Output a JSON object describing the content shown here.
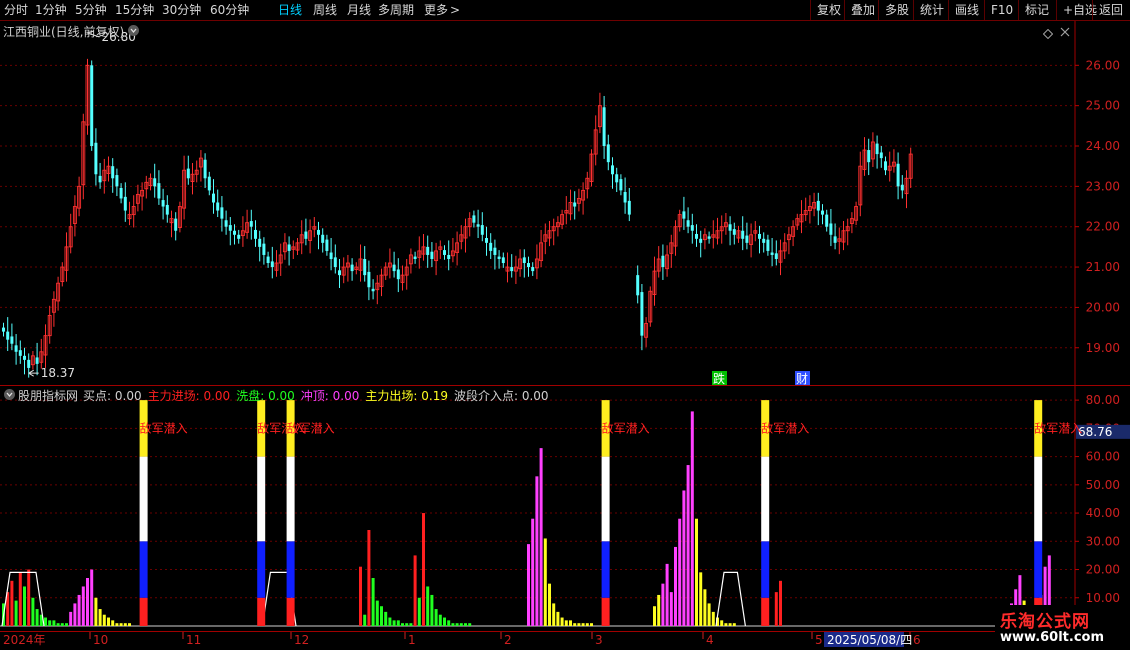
{
  "toolbar": {
    "periods": [
      {
        "label": "分时",
        "name": "tab-fenshi"
      },
      {
        "label": "1分钟",
        "name": "tab-1min"
      },
      {
        "label": "5分钟",
        "name": "tab-5min"
      },
      {
        "label": "15分钟",
        "name": "tab-15min"
      },
      {
        "label": "30分钟",
        "name": "tab-30min"
      },
      {
        "label": "60分钟",
        "name": "tab-60min"
      },
      {
        "label": "日线",
        "name": "tab-daily"
      },
      {
        "label": "周线",
        "name": "tab-weekly"
      },
      {
        "label": "月线",
        "name": "tab-monthly"
      },
      {
        "label": "多周期",
        "name": "tab-multi-period"
      },
      {
        "label": "更多",
        "name": "tab-more"
      }
    ],
    "more_arrow": ">",
    "active_period": "日线",
    "actions": [
      {
        "label": "复权",
        "name": "adjust-button"
      },
      {
        "label": "叠加",
        "name": "overlay-button"
      },
      {
        "label": "多股",
        "name": "multi-stock-button"
      },
      {
        "label": "统计",
        "name": "statistics-button"
      },
      {
        "label": "画线",
        "name": "draw-line-button"
      },
      {
        "label": "F10",
        "name": "f10-button"
      },
      {
        "label": "标记",
        "name": "mark-button"
      },
      {
        "label": "+自选",
        "name": "add-watchlist-button"
      },
      {
        "label": "返回",
        "name": "back-button"
      }
    ]
  },
  "main_chart": {
    "title": "江西铜业(日线,前复权)",
    "y_ticks": [
      "26.00",
      "25.00",
      "24.00",
      "23.00",
      "22.00",
      "21.00",
      "20.00",
      "19.00"
    ],
    "high_label": "26.80",
    "low_label": "18.37",
    "events": [
      {
        "label": "跌",
        "color": "#00c000"
      },
      {
        "label": "财",
        "color": "#3050ff"
      }
    ],
    "up_color": "#ff3030",
    "down_color": "#54ffff"
  },
  "indicator": {
    "name": "股朋指标网",
    "items": [
      {
        "label": "买点",
        "value": "0.00",
        "color": "#d0d0d0"
      },
      {
        "label": "主力进场",
        "value": "0.00",
        "color": "#ff2020"
      },
      {
        "label": "洗盘",
        "value": "0.00",
        "color": "#20ff20"
      },
      {
        "label": "冲顶",
        "value": "0.00",
        "color": "#ff40ff"
      },
      {
        "label": "主力出场",
        "value": "0.19",
        "color": "#ffff20"
      },
      {
        "label": "波段介入点",
        "value": "0.00",
        "color": "#d0d0d0"
      }
    ],
    "y_ticks": [
      "80.00",
      "70.00",
      "60.00",
      "50.00",
      "40.00",
      "30.00",
      "20.00",
      "10.00"
    ],
    "current_value": "68.76",
    "signal_text": "敌军潜入"
  },
  "time_axis": {
    "start_label": "2024年",
    "months": [
      "10",
      "11",
      "12",
      "1",
      "2",
      "3",
      "4",
      "5",
      "6"
    ],
    "cursor_date": "2025/05/08/四"
  },
  "watermark": {
    "title": "乐淘公式网",
    "url": "www.60lt.com"
  },
  "chart_data": [
    {
      "type": "candlestick",
      "title": "江西铜业(日线,前复权)",
      "ylim": [
        18.3,
        26.9
      ],
      "high": 26.8,
      "low": 18.37,
      "closes": [
        19.4,
        19.2,
        19.1,
        18.9,
        18.8,
        18.7,
        18.5,
        18.8,
        18.6,
        18.9,
        19.3,
        19.8,
        20.2,
        20.6,
        21.0,
        21.5,
        22.0,
        22.5,
        23.0,
        24.6,
        26.0,
        24.0,
        23.3,
        23.1,
        23.4,
        23.5,
        23.2,
        23.0,
        22.7,
        22.4,
        22.3,
        22.5,
        22.8,
        22.9,
        23.1,
        23.2,
        23.0,
        22.7,
        22.5,
        22.3,
        22.2,
        21.9,
        22.5,
        23.4,
        23.2,
        23.3,
        23.4,
        23.7,
        23.2,
        22.9,
        22.6,
        22.4,
        22.2,
        22.0,
        21.9,
        21.8,
        21.7,
        21.9,
        22.1,
        22.0,
        21.7,
        21.5,
        21.3,
        21.1,
        21.0,
        21.1,
        21.3,
        21.6,
        21.4,
        21.5,
        21.6,
        21.8,
        21.7,
        21.9,
        22.0,
        21.8,
        21.6,
        21.4,
        21.2,
        21.0,
        20.8,
        21.0,
        21.1,
        20.9,
        21.0,
        21.2,
        20.8,
        20.5,
        20.4,
        20.6,
        20.8,
        21.0,
        21.1,
        20.9,
        20.7,
        20.8,
        21.0,
        21.3,
        21.2,
        21.4,
        21.5,
        21.3,
        21.2,
        21.4,
        21.5,
        21.3,
        21.2,
        21.4,
        21.6,
        21.8,
        22.0,
        22.2,
        22.1,
        22.0,
        21.8,
        21.6,
        21.4,
        21.3,
        21.2,
        21.1,
        21.0,
        20.9,
        21.0,
        21.2,
        21.1,
        21.0,
        20.9,
        21.2,
        21.6,
        21.8,
        21.9,
        22.0,
        22.1,
        22.3,
        22.4,
        22.6,
        22.5,
        22.7,
        22.9,
        23.2,
        23.8,
        24.4,
        25.0,
        24.0,
        23.6,
        23.3,
        23.1,
        22.9,
        22.6,
        22.3,
        null,
        20.3,
        19.3,
        19.6,
        20.4,
        20.9,
        21.2,
        21.0,
        21.3,
        21.6,
        22.0,
        22.3,
        22.2,
        22.0,
        21.9,
        21.7,
        21.6,
        21.8,
        21.7,
        21.8,
        21.9,
        22.0,
        22.1,
        21.9,
        21.8,
        21.9,
        21.7,
        21.6,
        21.8,
        21.9,
        21.7,
        21.6,
        21.4,
        21.3,
        21.2,
        21.4,
        21.6,
        21.8,
        22.0,
        22.2,
        22.3,
        22.4,
        22.5,
        22.6,
        22.4,
        22.3,
        22.0,
        21.8,
        21.6,
        21.7,
        21.9,
        22.0,
        22.2,
        22.5,
        23.5,
        23.9,
        23.6,
        24.1,
        23.8,
        23.7,
        23.4,
        23.5,
        23.6,
        23.0,
        22.9,
        23.2,
        23.8
      ],
      "events": [
        "跌",
        "财"
      ]
    },
    {
      "type": "bar",
      "title": "股朋指标网",
      "ylim": [
        0,
        85
      ],
      "current_value": 68.76,
      "signal_value": 0.19,
      "series": [
        {
          "name": "主力进场",
          "color": "#ff2020",
          "bars": [
            [
              1,
              12
            ],
            [
              2,
              16
            ],
            [
              4,
              19
            ],
            [
              6,
              20
            ],
            [
              85,
              21
            ],
            [
              87,
              34
            ],
            [
              98,
              25
            ],
            [
              100,
              40
            ],
            [
              184,
              12
            ],
            [
              185,
              16
            ]
          ]
        },
        {
          "name": "洗盘",
          "color": "#20ff20",
          "bars": [
            [
              0,
              8
            ],
            [
              3,
              9
            ],
            [
              5,
              14
            ],
            [
              7,
              10
            ],
            [
              8,
              6
            ],
            [
              9,
              4
            ],
            [
              10,
              3
            ],
            [
              11,
              2
            ],
            [
              12,
              2
            ],
            [
              13,
              1
            ],
            [
              14,
              1
            ],
            [
              15,
              1
            ],
            [
              86,
              4
            ],
            [
              88,
              17
            ],
            [
              89,
              9
            ],
            [
              90,
              7
            ],
            [
              91,
              5
            ],
            [
              92,
              3
            ],
            [
              93,
              2
            ],
            [
              94,
              2
            ],
            [
              95,
              1
            ],
            [
              96,
              1
            ],
            [
              97,
              1
            ],
            [
              99,
              10
            ],
            [
              101,
              14
            ],
            [
              102,
              11
            ],
            [
              103,
              6
            ],
            [
              104,
              4
            ],
            [
              105,
              3
            ],
            [
              106,
              2
            ],
            [
              107,
              1
            ],
            [
              108,
              1
            ],
            [
              109,
              1
            ],
            [
              110,
              1
            ],
            [
              111,
              1
            ]
          ]
        },
        {
          "name": "冲顶",
          "color": "#ff40ff",
          "bars": [
            [
              16,
              5
            ],
            [
              17,
              8
            ],
            [
              18,
              11
            ],
            [
              19,
              14
            ],
            [
              20,
              17
            ],
            [
              21,
              20
            ],
            [
              125,
              29
            ],
            [
              126,
              38
            ],
            [
              127,
              53
            ],
            [
              128,
              63
            ],
            [
              157,
              15
            ],
            [
              158,
              22
            ],
            [
              159,
              12
            ],
            [
              160,
              28
            ],
            [
              161,
              38
            ],
            [
              162,
              48
            ],
            [
              163,
              57
            ],
            [
              164,
              76
            ],
            [
              240,
              8
            ],
            [
              241,
              13
            ],
            [
              242,
              18
            ],
            [
              247,
              11
            ],
            [
              248,
              21
            ],
            [
              249,
              25
            ]
          ]
        },
        {
          "name": "主力出场",
          "color": "#ffff20",
          "bars": [
            [
              22,
              10
            ],
            [
              23,
              6
            ],
            [
              24,
              4
            ],
            [
              25,
              3
            ],
            [
              26,
              2
            ],
            [
              27,
              1
            ],
            [
              28,
              1
            ],
            [
              29,
              1
            ],
            [
              30,
              1
            ],
            [
              129,
              31
            ],
            [
              130,
              15
            ],
            [
              131,
              8
            ],
            [
              132,
              5
            ],
            [
              133,
              3
            ],
            [
              134,
              2
            ],
            [
              135,
              2
            ],
            [
              136,
              1
            ],
            [
              137,
              1
            ],
            [
              138,
              1
            ],
            [
              139,
              1
            ],
            [
              140,
              1
            ],
            [
              155,
              7
            ],
            [
              156,
              11
            ],
            [
              165,
              38
            ],
            [
              166,
              19
            ],
            [
              167,
              13
            ],
            [
              168,
              8
            ],
            [
              169,
              5
            ],
            [
              170,
              3
            ],
            [
              171,
              2
            ],
            [
              172,
              1
            ],
            [
              173,
              1
            ],
            [
              174,
              1
            ],
            [
              243,
              9
            ],
            [
              244,
              5
            ],
            [
              245,
              3
            ],
            [
              246,
              2
            ],
            [
              250,
              2
            ]
          ]
        }
      ],
      "signals": [
        33,
        61,
        68,
        143,
        181,
        246
      ]
    }
  ]
}
